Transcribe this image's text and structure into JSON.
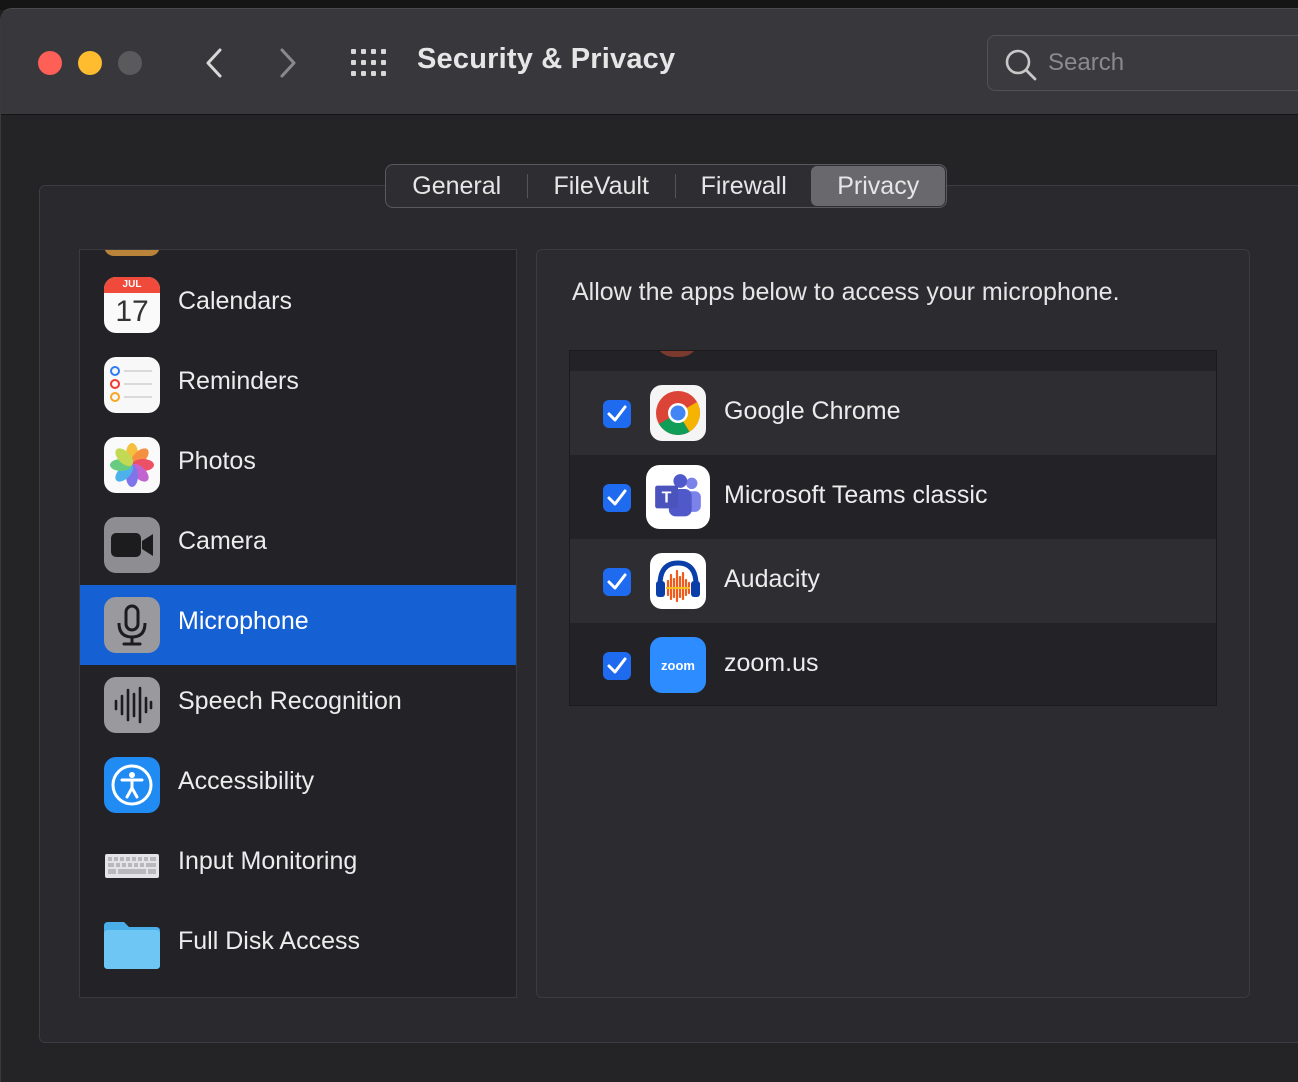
{
  "window": {
    "title": "Security & Privacy",
    "search_placeholder": "Search"
  },
  "tabs": [
    {
      "label": "General",
      "selected": false
    },
    {
      "label": "FileVault",
      "selected": false
    },
    {
      "label": "Firewall",
      "selected": false
    },
    {
      "label": "Privacy",
      "selected": true
    }
  ],
  "sidebar": {
    "items": [
      {
        "label": "Calendars",
        "icon": "calendar-icon",
        "calendar_month": "JUL",
        "calendar_day": "17"
      },
      {
        "label": "Reminders",
        "icon": "reminders-icon"
      },
      {
        "label": "Photos",
        "icon": "photos-icon"
      },
      {
        "label": "Camera",
        "icon": "camera-icon"
      },
      {
        "label": "Microphone",
        "icon": "microphone-icon",
        "selected": true
      },
      {
        "label": "Speech Recognition",
        "icon": "speech-recognition-icon"
      },
      {
        "label": "Accessibility",
        "icon": "accessibility-icon"
      },
      {
        "label": "Input Monitoring",
        "icon": "keyboard-icon"
      },
      {
        "label": "Full Disk Access",
        "icon": "folder-icon"
      }
    ]
  },
  "panel": {
    "heading": "Allow the apps below to access your microphone.",
    "apps": [
      {
        "name": "Google Chrome",
        "checked": true,
        "icon": "chrome-icon"
      },
      {
        "name": "Microsoft Teams classic",
        "checked": true,
        "icon": "teams-icon"
      },
      {
        "name": "Audacity",
        "checked": true,
        "icon": "audacity-icon"
      },
      {
        "name": "zoom.us",
        "checked": true,
        "icon": "zoom-icon",
        "icon_text": "zoom"
      }
    ]
  },
  "colors": {
    "selection": "#1561d3",
    "checkbox": "#1e6bf0",
    "close": "#fe5f57",
    "minimize": "#febc2e"
  }
}
